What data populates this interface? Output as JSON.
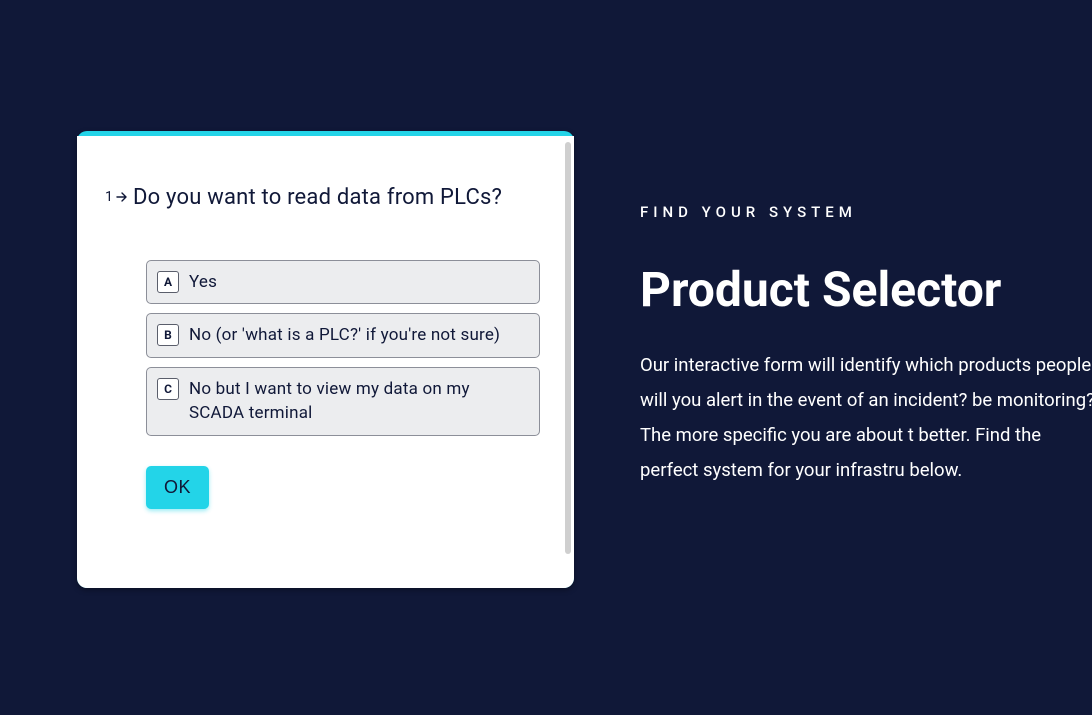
{
  "form": {
    "question_number": "1",
    "question_text": "Do you want to read data from PLCs?",
    "options": [
      {
        "key": "A",
        "label": "Yes"
      },
      {
        "key": "B",
        "label": "No (or 'what is a PLC?' if you're not sure)"
      },
      {
        "key": "C",
        "label": "No but I want to view my data on my SCADA terminal"
      }
    ],
    "ok_label": "OK"
  },
  "rhs": {
    "eyebrow": "FIND YOUR SYSTEM",
    "headline": "Product Selector",
    "body": "Our interactive form will identify which products people will you alert in the event of an incident? be monitoring? The more specific you are about t better. Find the perfect system for your infrastru below."
  }
}
